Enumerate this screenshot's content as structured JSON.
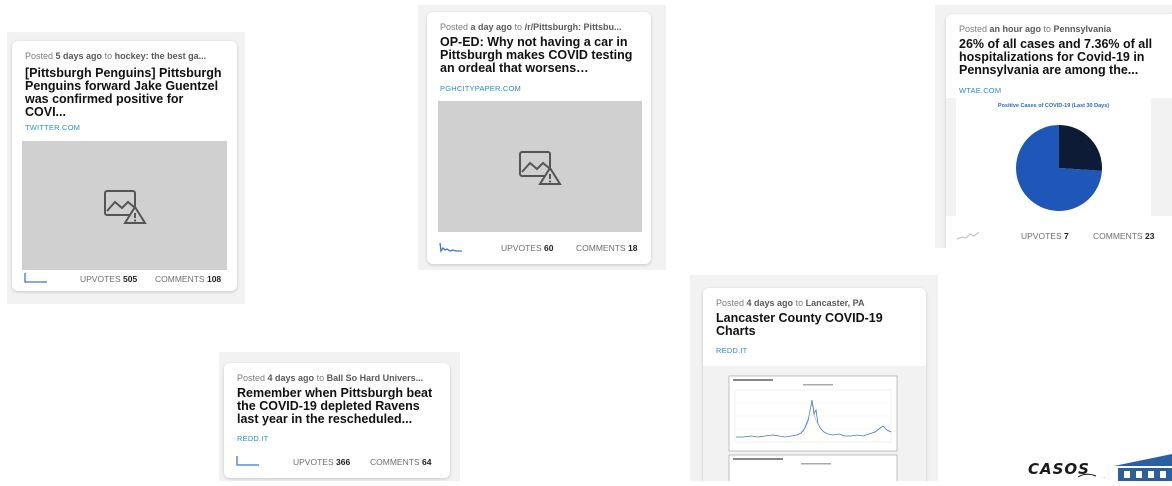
{
  "cards": [
    {
      "id": "penguins",
      "meta_prefix": "Posted ",
      "meta_age": "5 days ago",
      "meta_to": " to ",
      "meta_sub": "hockey: the best ga...",
      "title": "[Pittsburgh Penguins] Pittsburgh Penguins forward Jake Guentzel was confirmed positive for COVI...",
      "domain": "TWITTER.COM",
      "upvotes_label": "UPVOTES",
      "upvotes": "505",
      "comments_label": "COMMENTS",
      "comments": "108"
    },
    {
      "id": "oped",
      "meta_prefix": "Posted ",
      "meta_age": "a day ago",
      "meta_to": " to ",
      "meta_sub": "/r/Pittsburgh: Pittsbu...",
      "title": "OP-ED: Why not having a car in Pittsburgh makes COVID testing an ordeal that worsens communi...",
      "domain": "PGHCITYPAPER.COM",
      "upvotes_label": "UPVOTES",
      "upvotes": "60",
      "comments_label": "COMMENTS",
      "comments": "18"
    },
    {
      "id": "pennsylvania",
      "meta_prefix": "Posted ",
      "meta_age": "an hour ago",
      "meta_to": " to ",
      "meta_sub": "Pennsylvania",
      "title": "26% of all cases and 7.36% of all hospitalizations for Covid-19 in Pennsylvania are among the...",
      "domain": "WTAE.COM",
      "thumb_chart_title": "Positive Cases of COVID-19 (Last 30 Days)",
      "pie_fraction_dark": 0.26,
      "upvotes_label": "UPVOTES",
      "upvotes": "7",
      "comments_label": "COMMENTS",
      "comments": "23"
    },
    {
      "id": "ravens",
      "meta_prefix": "Posted ",
      "meta_age": "4 days ago",
      "meta_to": " to ",
      "meta_sub": "Ball So Hard Univers...",
      "title": "Remember when Pittsburgh beat the COVID-19 depleted Ravens last year in the rescheduled...",
      "domain": "REDD.IT",
      "upvotes_label": "UPVOTES",
      "upvotes": "366",
      "comments_label": "COMMENTS",
      "comments": "64"
    },
    {
      "id": "lancaster",
      "meta_prefix": "Posted ",
      "meta_age": "4 days ago",
      "meta_to": " to ",
      "meta_sub": "Lancaster, PA",
      "title": "Lancaster County COVID-19 Charts",
      "domain": "REDD.IT"
    }
  ],
  "logo": {
    "text": "CASOS"
  },
  "colors": {
    "panel_bg": "#f2f2f2",
    "link_blue": "#2a8fd6",
    "pie_blue": "#1f57b8",
    "pie_dark": "#0d1b36",
    "placeholder": "#d0d0d0"
  },
  "icons": [
    "broken-image-icon",
    "sparkline-icon"
  ]
}
